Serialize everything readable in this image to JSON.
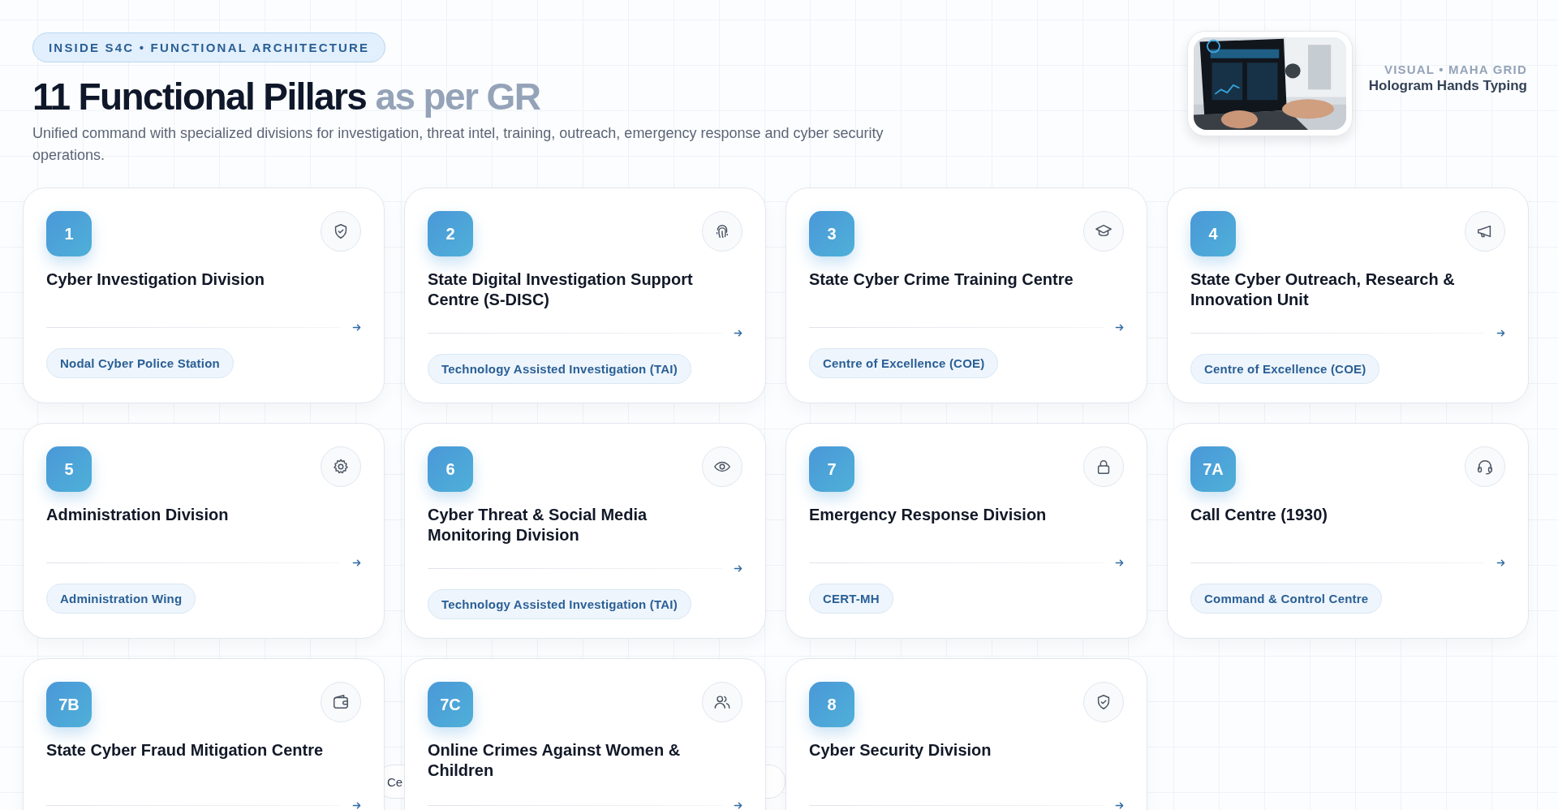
{
  "header": {
    "eyebrow": "INSIDE S4C • FUNCTIONAL ARCHITECTURE",
    "title": "11 Functional Pillars",
    "title_muted": "as per GR",
    "subtitle": "Unified command with specialized divisions for investigation, threat intel, training, outreach, emergency response and cyber security operations."
  },
  "visual": {
    "kind": "picture",
    "label": "VISUAL • MAHA GRID",
    "caption": "Hologram Hands Typing"
  },
  "pillars": [
    {
      "number": "1",
      "title": "Cyber Investigation Division",
      "tag": "Nodal Cyber Police Station"
    },
    {
      "number": "2",
      "title": "State Digital Investigation Support Centre (S-DISC)",
      "tag": "Technology Assisted Investigation (TAI)"
    },
    {
      "number": "3",
      "title": "State Cyber Crime Training Centre",
      "tag": "Centre of Excellence (COE)"
    },
    {
      "number": "4",
      "title": "State Cyber Outreach, Research & Innovation Unit",
      "tag": "Centre of Excellence (COE)"
    },
    {
      "number": "5",
      "title": "Administration Division",
      "tag": "Administration Wing"
    },
    {
      "number": "6",
      "title": "Cyber Threat & Social Media Monitoring Division",
      "tag": "Technology Assisted Investigation (TAI)"
    },
    {
      "number": "7",
      "title": "Emergency Response Division",
      "tag": "CERT-MH"
    },
    {
      "number": "7A",
      "title": "Call Centre (1930)",
      "tag": "Command & Control Centre"
    },
    {
      "number": "7B",
      "title": "State Cyber Fraud Mitigation Centre"
    },
    {
      "number": "7C",
      "title": "Online Crimes Against Women & Children"
    },
    {
      "number": "8",
      "title": "Cyber Security Division"
    }
  ],
  "background_chip": "Ce"
}
